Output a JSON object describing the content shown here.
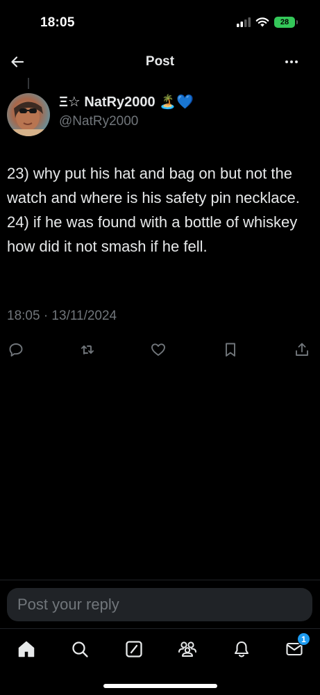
{
  "status_bar": {
    "time": "18:05",
    "battery_level": "28",
    "battery_color": "#34c759",
    "icons": [
      "signal-icon",
      "wifi-icon",
      "battery-icon"
    ]
  },
  "nav": {
    "title": "Post",
    "back_icon": "arrow-left-icon",
    "more_icon": "more-horizontal-icon"
  },
  "post": {
    "author": {
      "display_name": "Ξ☆ NatRy2000 🏝️💙",
      "handle": "@NatRy2000"
    },
    "text": "23) why put his hat and bag on but not the watch and where is his safety pin necklace. 24) if he was found with a bottle of whiskey how did it not smash if he fell.",
    "timestamp": "18:05 · 13/11/2024",
    "actions": [
      "reply-icon",
      "repost-icon",
      "like-icon",
      "bookmark-icon",
      "share-icon"
    ]
  },
  "reply": {
    "placeholder": "Post your reply"
  },
  "tab_bar": {
    "items": [
      "home-icon",
      "search-icon",
      "grok-icon",
      "communities-icon",
      "notifications-icon",
      "messages-icon"
    ],
    "messages_badge": "1",
    "badge_color": "#1d9bf0"
  },
  "colors": {
    "background": "#000000",
    "primary_text": "#e7e9ea",
    "secondary_text": "#71767b",
    "divider": "#202327"
  }
}
